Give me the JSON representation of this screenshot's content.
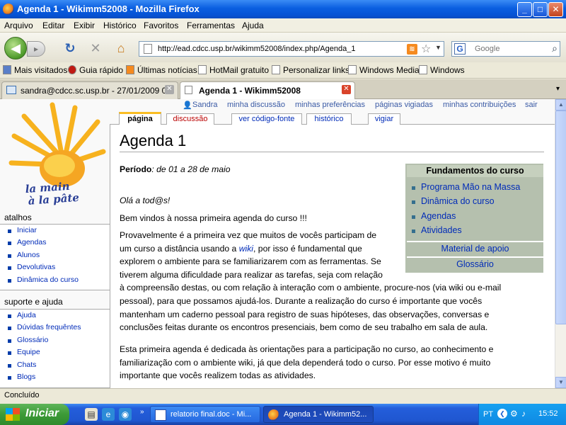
{
  "window": {
    "title": "Agenda 1 - Wikimm52008 - Mozilla Firefox",
    "min": "_",
    "max": "□",
    "close": "✕"
  },
  "menu": [
    "Arquivo",
    "Editar",
    "Exibir",
    "Histórico",
    "Favoritos",
    "Ferramentas",
    "Ajuda"
  ],
  "nav": {
    "back_icon": "◀",
    "forward_icon": "▸",
    "reload_icon": "↻",
    "stop_icon": "✕",
    "home_icon": "⌂",
    "url": "http://ead.cdcc.usp.br/wikimm52008/index.php/Agenda_1",
    "rss": "≋",
    "star": "☆",
    "search_engine": "G",
    "search_placeholder": "Google",
    "search_icon": "⌕"
  },
  "bookmarks": [
    "Mais visitados",
    "Guia rápido",
    "Últimas notícias",
    "HotMail gratuito",
    "Personalizar links",
    "Windows Media",
    "Windows"
  ],
  "tabs": [
    {
      "label": "sandra@cdcc.sc.usp.br - 27/01/2009 0...",
      "active": false,
      "close": "✕"
    },
    {
      "label": "Agenda 1 - Wikimm52008",
      "active": true,
      "close": "✕"
    }
  ],
  "tab_scroll": "▾",
  "personal": [
    "Sandra",
    "minha discussão",
    "minhas preferências",
    "páginas vigiadas",
    "minhas contribuições",
    "sair"
  ],
  "page_tabs": {
    "page": "página",
    "talk": "discussão",
    "source": "ver código-fonte",
    "history": "histórico",
    "watch": "vigiar"
  },
  "logo": {
    "line1": "la main",
    "line2": "à la pâte"
  },
  "sidebar": {
    "nav_title": "atalhos",
    "nav_items": [
      "Iniciar",
      "Agendas",
      "Alunos",
      "Devolutivas",
      "Dinâmica do curso"
    ],
    "help_title": "suporte e ajuda",
    "help_items": [
      "Ajuda",
      "Dúvidas frequêntes",
      "Glossário",
      "Equipe",
      "Chats",
      "Blogs"
    ]
  },
  "article": {
    "title": "Agenda 1",
    "period_label": "Período",
    "period_value": ": de 01 a 28 de maio",
    "greeting": "Olá a tod@s!",
    "welcome": "Bem vindos à nossa primeira agenda do curso !!!",
    "p1_lines": [
      "Provavelmente é a primeira vez que muitos de vocês participam de",
      "um curso a distância usando a ",
      "explorem o ambiente para se familiarizarem com as ferramentas. Se",
      "tiverem alguma dificuldade para realizar as tarefas, seja com relação",
      "à compreensão destas, ou com relação à interação com o ambiente, procure-nos (via wiki ou e-mail",
      "pessoal), para que possamos ajudá-los. Durante a realização do curso é importante que vocês",
      "mantenham um caderno pessoal para registro de suas hipóteses, das observações, conversas e",
      "conclusões feitas durante os encontros presenciais, bem como de seu trabalho em sala de aula."
    ],
    "p1_wiki": "wiki",
    "p1_line2_tail": ", por isso é fundamental que",
    "p2_lines": [
      "Esta primeira agenda é dedicada às orientações para a participação no curso, ao conhecimento e",
      "familiarização com o ambiente wiki, já que dela dependerá todo o curso. Por esse motivo é muito",
      "importante que vocês realizem todas as atividades."
    ]
  },
  "fund_box": {
    "title": "Fundamentos do curso",
    "items": [
      "Programa Mão na Massa",
      "Dinâmica do curso",
      "Agendas",
      "Atividades"
    ],
    "material": "Material de apoio",
    "glossary": "Glossário"
  },
  "status": "Concluído",
  "taskbar": {
    "start": "Iniciar",
    "tasks": [
      "relatorio final.doc - Mi...",
      "Agenda 1 - Wikimm52..."
    ],
    "lang": "PT",
    "clock": "15:52"
  }
}
